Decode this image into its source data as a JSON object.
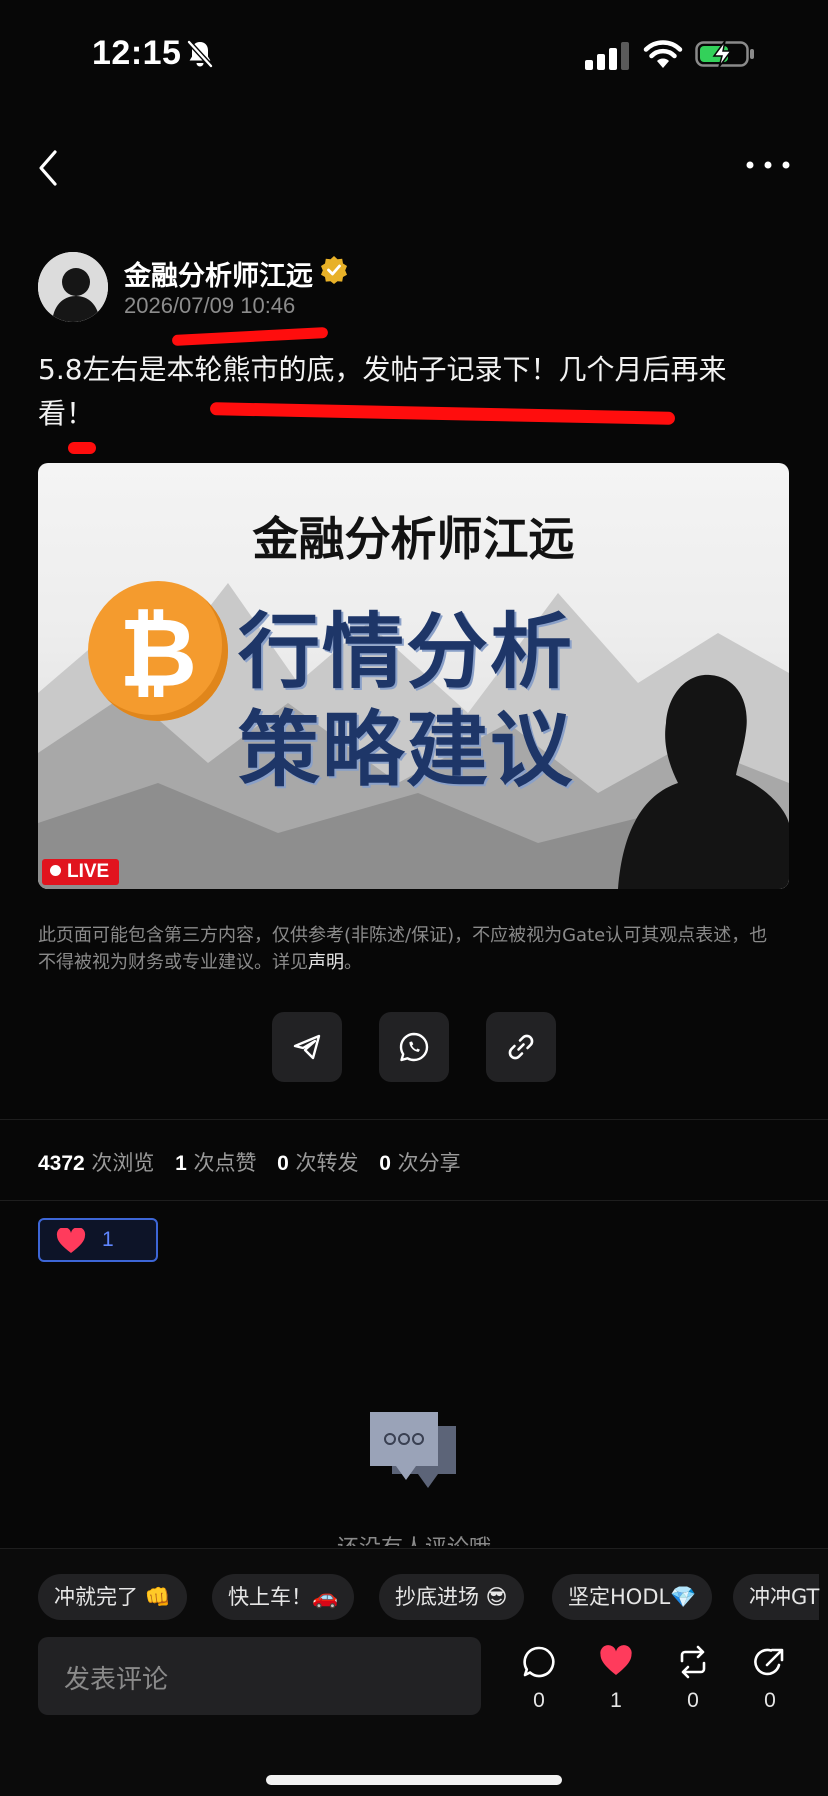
{
  "status_bar": {
    "time": "12:15"
  },
  "post": {
    "author": "金融分析师江远",
    "time": "2026/07/09 10:46",
    "text": "5.8左右是本轮熊市的底，发帖子记录下！几个月后再来看！"
  },
  "banner": {
    "title": "金融分析师江远",
    "line1": "行情分析",
    "line2": "策略建议",
    "btc_symbol": "₿",
    "live_label": "LIVE"
  },
  "disclaimer": {
    "text": "此页面可能包含第三方内容，仅供参考(非陈述/保证)，不应被视为Gate认可其观点表述，也不得被视为财务或专业建议。详见",
    "link": "声明",
    "end": "。"
  },
  "stats": {
    "views": "4372",
    "views_label": "次浏览",
    "likes": "1",
    "likes_label": "次点赞",
    "reposts": "0",
    "reposts_label": "次转发",
    "shares": "0",
    "shares_label": "次分享"
  },
  "reaction": {
    "count": "1"
  },
  "comments": {
    "empty_text": "还没有人评论哦"
  },
  "quick_replies": [
    "冲就完了 👊",
    "快上车！🚗",
    "抄底进场 😎",
    "坚定HODL💎",
    "冲冲GT"
  ],
  "bottom": {
    "comment_placeholder": "发表评论",
    "comment_count": "0",
    "like_count": "1",
    "repost_count": "0",
    "share_count": "0"
  },
  "colors": {
    "accent_red": "#ff0d0d",
    "heart": "#ff3b5c",
    "btc_orange": "#f49b2e",
    "reaction_border": "#3d66d6"
  }
}
